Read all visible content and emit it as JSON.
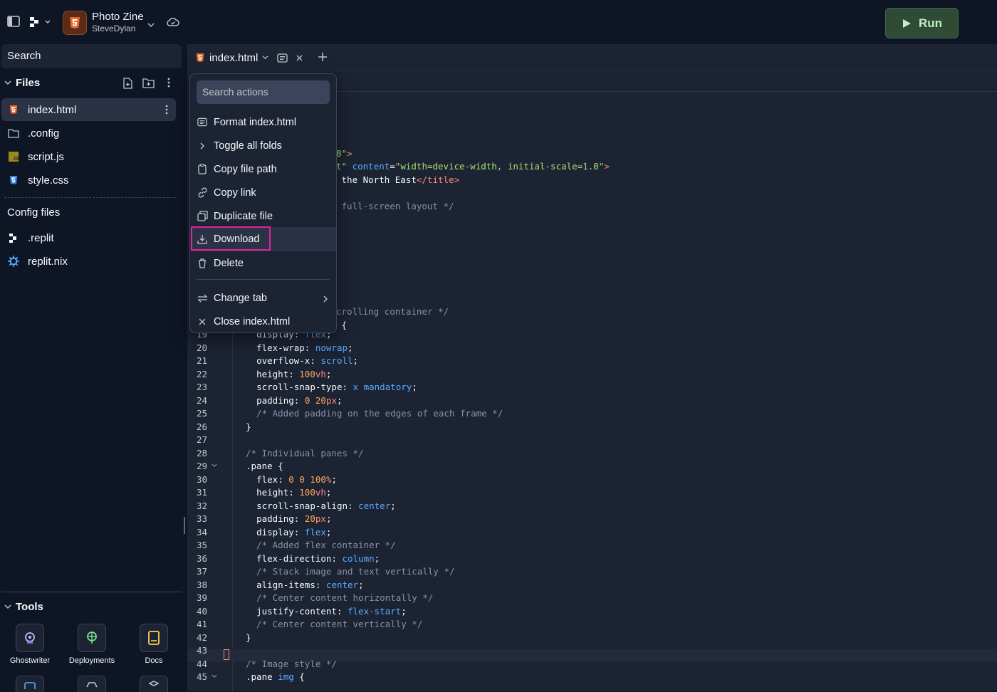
{
  "topbar": {
    "repl_title": "Photo Zine",
    "repl_owner": "SteveDylan",
    "run_label": "Run"
  },
  "sidebar": {
    "search_placeholder": "Search",
    "files_header": "Files",
    "files": [
      {
        "name": "index.html",
        "icon": "html5-icon"
      },
      {
        "name": ".config",
        "icon": "folder-icon"
      },
      {
        "name": "script.js",
        "icon": "js-icon"
      },
      {
        "name": "style.css",
        "icon": "css3-icon"
      }
    ],
    "config_header": "Config files",
    "config_files": [
      {
        "name": ".replit",
        "icon": "replit-icon"
      },
      {
        "name": "replit.nix",
        "icon": "nix-icon"
      }
    ],
    "tools_header": "Tools",
    "tools": [
      "Ghostwriter",
      "Deployments",
      "Docs"
    ]
  },
  "editor": {
    "tab_label": "index.html",
    "code_partial": [
      {
        "n": "",
        "text": "8\">"
      },
      {
        "n": "",
        "text": "t\" content=\"width=device-width, initial-scale=1.0\">"
      },
      {
        "n": "",
        "text": " the North East</title>"
      },
      {
        "n": "",
        "text": " full-screen layout */"
      },
      {
        "n": "",
        "text": "crolling container */"
      },
      {
        "n": "",
        "text": " {"
      }
    ],
    "lines": [
      {
        "n": "19",
        "text": "  display: flex;"
      },
      {
        "n": "20",
        "text": "  flex-wrap: nowrap;"
      },
      {
        "n": "21",
        "text": "  overflow-x: scroll;"
      },
      {
        "n": "22",
        "text": "  height: 100vh;"
      },
      {
        "n": "23",
        "text": "  scroll-snap-type: x mandatory;"
      },
      {
        "n": "24",
        "text": "  padding: 0 20px;"
      },
      {
        "n": "25",
        "text": "  /* Added padding on the edges of each frame */"
      },
      {
        "n": "26",
        "text": "}"
      },
      {
        "n": "27",
        "text": ""
      },
      {
        "n": "28",
        "text": "/* Individual panes */"
      },
      {
        "n": "29",
        "text": ".pane {"
      },
      {
        "n": "30",
        "text": "  flex: 0 0 100%;"
      },
      {
        "n": "31",
        "text": "  height: 100vh;"
      },
      {
        "n": "32",
        "text": "  scroll-snap-align: center;"
      },
      {
        "n": "33",
        "text": "  padding: 20px;"
      },
      {
        "n": "34",
        "text": "  display: flex;"
      },
      {
        "n": "35",
        "text": "  /* Added flex container */"
      },
      {
        "n": "36",
        "text": "  flex-direction: column;"
      },
      {
        "n": "37",
        "text": "  /* Stack image and text vertically */"
      },
      {
        "n": "38",
        "text": "  align-items: center;"
      },
      {
        "n": "39",
        "text": "  /* Center content horizontally */"
      },
      {
        "n": "40",
        "text": "  justify-content: flex-start;"
      },
      {
        "n": "41",
        "text": "  /* Center content vertically */"
      },
      {
        "n": "42",
        "text": "}"
      },
      {
        "n": "43",
        "text": ""
      },
      {
        "n": "44",
        "text": "/* Image style */"
      },
      {
        "n": "45",
        "text": ".pane img {"
      }
    ]
  },
  "menu": {
    "search_placeholder": "Search actions",
    "items": [
      {
        "label": "Format index.html",
        "icon": "format-icon"
      },
      {
        "label": "Toggle all folds",
        "icon": "chevron-right-icon"
      },
      {
        "label": "Copy file path",
        "icon": "clipboard-icon"
      },
      {
        "label": "Copy link",
        "icon": "link-icon"
      },
      {
        "label": "Duplicate file",
        "icon": "duplicate-icon"
      },
      {
        "label": "Download",
        "icon": "download-icon"
      },
      {
        "label": "Delete",
        "icon": "trash-icon"
      },
      {
        "label": "Change tab",
        "icon": "swap-icon"
      },
      {
        "label": "Close index.html",
        "icon": "close-icon"
      }
    ]
  },
  "colors": {
    "background": "#0e1525",
    "panel": "#1c2333",
    "highlight_box": "#e0219a",
    "run_button": "#2f4a35"
  }
}
